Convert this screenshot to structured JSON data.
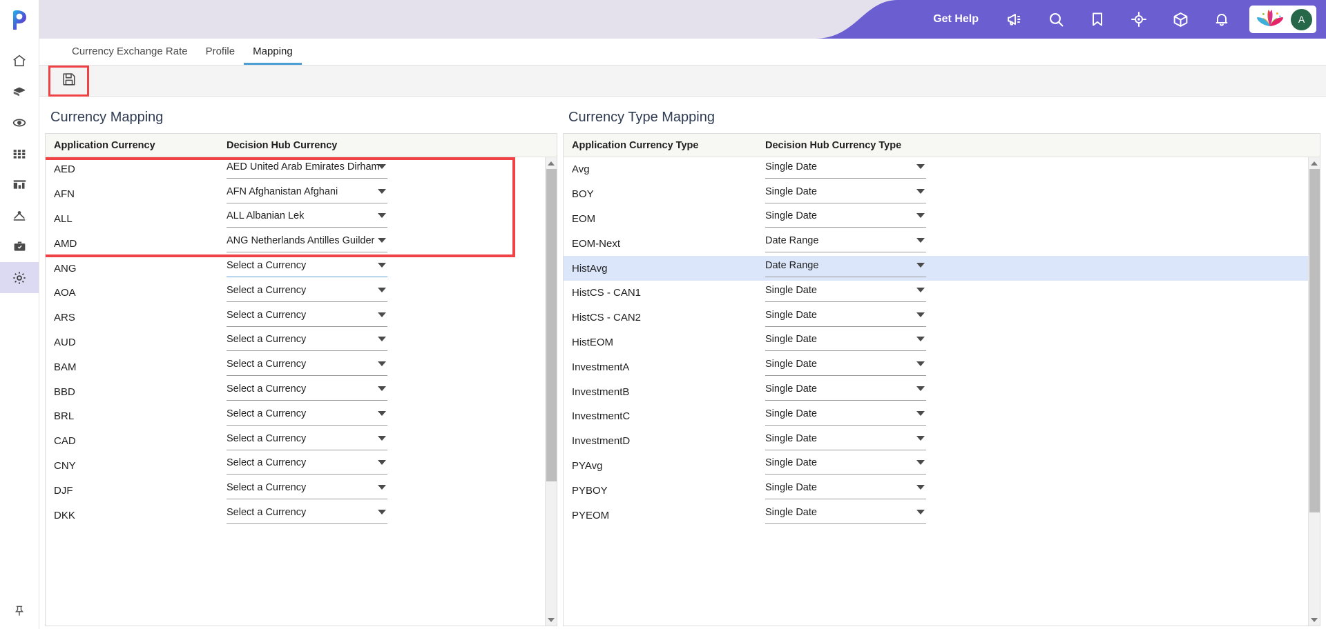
{
  "brand": {
    "accent": "#6b5ed0",
    "highlight": "#f04245",
    "selected_row": "#dbe6fb"
  },
  "header": {
    "get_help_label": "Get Help",
    "icons": [
      {
        "name": "megaphone-icon"
      },
      {
        "name": "search-icon"
      },
      {
        "name": "bookmark-icon"
      },
      {
        "name": "target-icon"
      },
      {
        "name": "box-icon"
      },
      {
        "name": "bell-icon"
      }
    ],
    "avatar_initial": "A"
  },
  "rail": {
    "logo": "pega-logo",
    "items": [
      {
        "name": "home-icon"
      },
      {
        "name": "cube-icon"
      },
      {
        "name": "eye-icon"
      },
      {
        "name": "grid-icon"
      },
      {
        "name": "chart-icon"
      },
      {
        "name": "hierarchy-icon"
      },
      {
        "name": "briefcase-icon"
      },
      {
        "name": "gear-icon",
        "active": true
      }
    ],
    "pin": {
      "name": "pin-icon"
    }
  },
  "tabs": [
    {
      "label": "Currency Exchange Rate",
      "active": false
    },
    {
      "label": "Profile",
      "active": false
    },
    {
      "label": "Mapping",
      "active": true
    }
  ],
  "toolbar": {
    "save_label": "save-icon"
  },
  "currency_mapping": {
    "title": "Currency Mapping",
    "columns": [
      "Application Currency",
      "Decision Hub Currency"
    ],
    "placeholder": "Select a Currency",
    "rows": [
      {
        "code": "AED",
        "value": "AED United Arab Emirates Dirham",
        "highlighted": true
      },
      {
        "code": "AFN",
        "value": "AFN Afghanistan Afghani",
        "highlighted": true
      },
      {
        "code": "ALL",
        "value": "ALL Albanian Lek",
        "highlighted": true
      },
      {
        "code": "AMD",
        "value": "ANG Netherlands Antilles Guilder",
        "highlighted": true
      },
      {
        "code": "ANG",
        "value": "Select a Currency",
        "focused": true
      },
      {
        "code": "AOA",
        "value": "Select a Currency"
      },
      {
        "code": "ARS",
        "value": "Select a Currency"
      },
      {
        "code": "AUD",
        "value": "Select a Currency"
      },
      {
        "code": "BAM",
        "value": "Select a Currency"
      },
      {
        "code": "BBD",
        "value": "Select a Currency"
      },
      {
        "code": "BRL",
        "value": "Select a Currency"
      },
      {
        "code": "CAD",
        "value": "Select a Currency"
      },
      {
        "code": "CNY",
        "value": "Select a Currency"
      },
      {
        "code": "DJF",
        "value": "Select a Currency"
      },
      {
        "code": "DKK",
        "value": "Select a Currency"
      }
    ],
    "scroll": {
      "thumb_top_pct": 0,
      "thumb_height_pct": 70
    }
  },
  "currency_type_mapping": {
    "title": "Currency Type Mapping",
    "columns": [
      "Application Currency Type",
      "Decision Hub Currency Type"
    ],
    "rows": [
      {
        "code": "Avg",
        "value": "Single Date"
      },
      {
        "code": "BOY",
        "value": "Single Date"
      },
      {
        "code": "EOM",
        "value": "Single Date"
      },
      {
        "code": "EOM-Next",
        "value": "Date Range"
      },
      {
        "code": "HistAvg",
        "value": "Date Range",
        "selected": true
      },
      {
        "code": "HistCS - CAN1",
        "value": "Single Date"
      },
      {
        "code": "HistCS - CAN2",
        "value": "Single Date"
      },
      {
        "code": "HistEOM",
        "value": "Single Date"
      },
      {
        "code": "InvestmentA",
        "value": "Single Date"
      },
      {
        "code": "InvestmentB",
        "value": "Single Date"
      },
      {
        "code": "InvestmentC",
        "value": "Single Date"
      },
      {
        "code": "InvestmentD",
        "value": "Single Date"
      },
      {
        "code": "PYAvg",
        "value": "Single Date"
      },
      {
        "code": "PYBOY",
        "value": "Single Date"
      },
      {
        "code": "PYEOM",
        "value": "Single Date"
      }
    ],
    "scroll": {
      "thumb_top_pct": 0,
      "thumb_height_pct": 77
    }
  }
}
